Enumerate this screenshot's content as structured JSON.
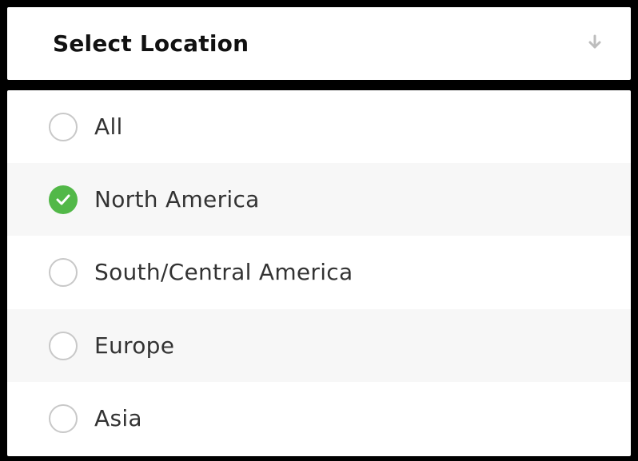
{
  "dropdown": {
    "title": "Select Location",
    "arrow_icon": "arrow-down-icon",
    "accent_color": "#52b848",
    "options": [
      {
        "label": "All",
        "selected": false
      },
      {
        "label": "North America",
        "selected": true
      },
      {
        "label": "South/Central America",
        "selected": false
      },
      {
        "label": "Europe",
        "selected": false
      },
      {
        "label": "Asia",
        "selected": false
      }
    ]
  }
}
